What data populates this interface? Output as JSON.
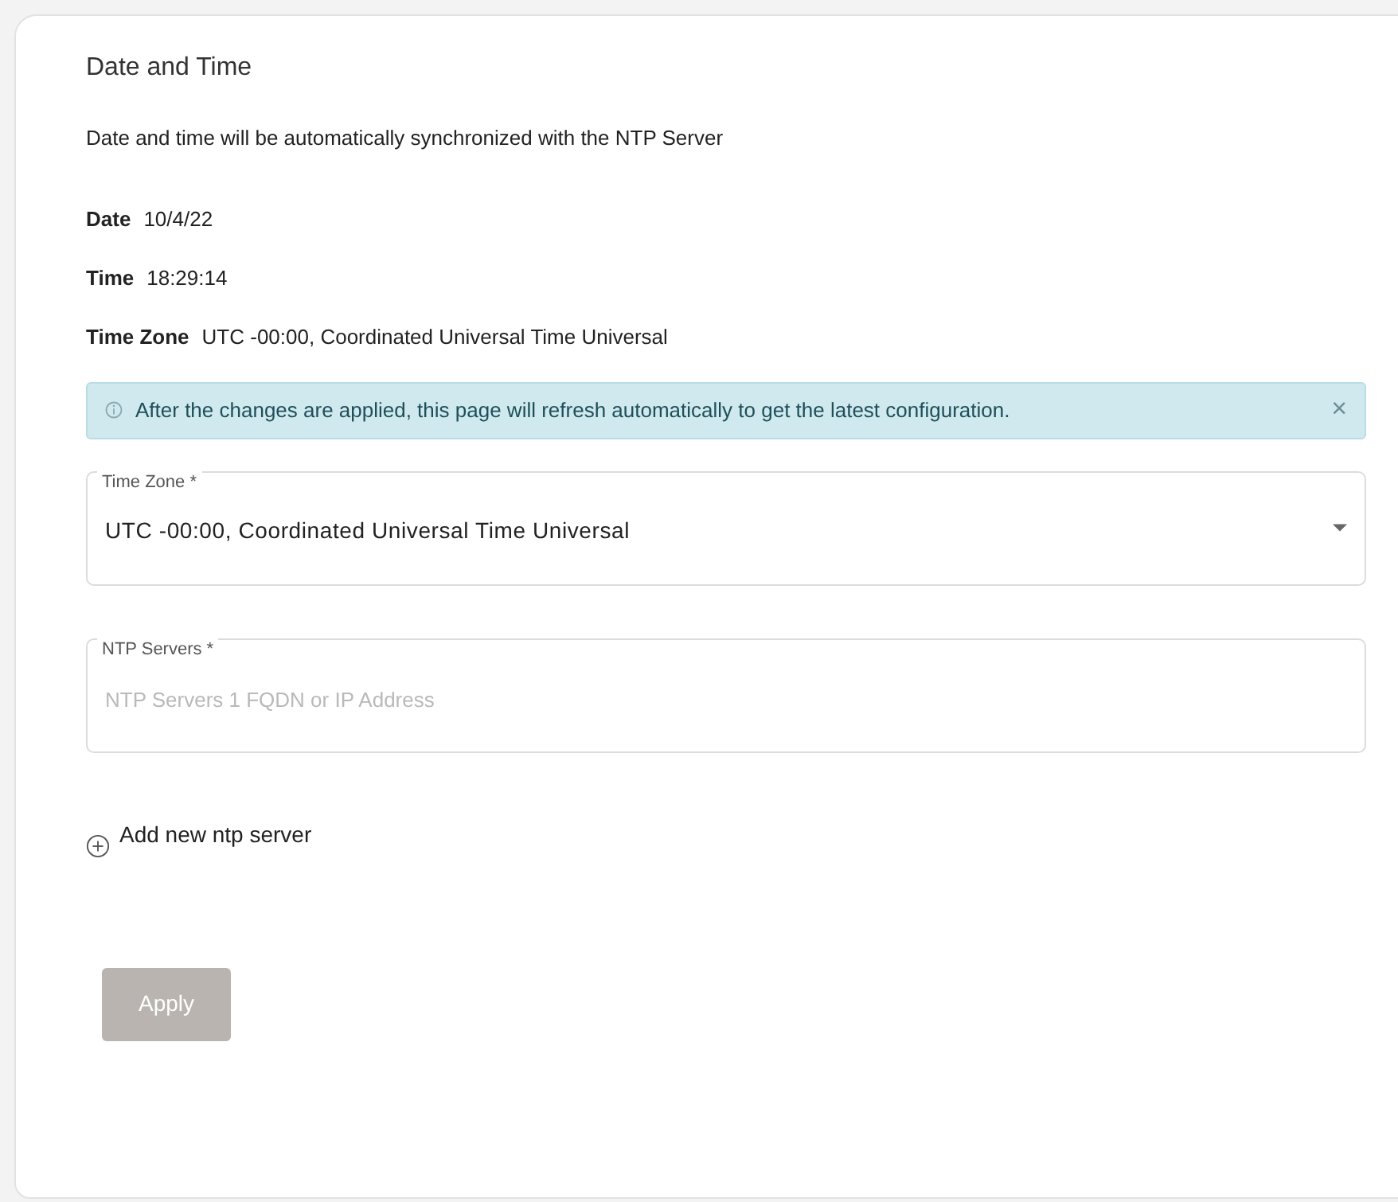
{
  "title": "Date and Time",
  "description": "Date and time will be automatically synchronized with the NTP Server",
  "info": [
    {
      "label": "Date",
      "value": "10/4/22"
    },
    {
      "label": "Time",
      "value": "18:29:14"
    },
    {
      "label": "Time Zone",
      "value": "UTC -00:00, Coordinated Universal Time Universal"
    }
  ],
  "alert": {
    "text": "After the changes are applied, this page will refresh automatically to get the latest configuration.",
    "close": "×"
  },
  "fields": [
    {
      "kind": "select",
      "label": "Time Zone *",
      "value": "UTC -00:00, Coordinated Universal Time Universal"
    },
    {
      "kind": "text",
      "label": "NTP Servers *",
      "placeholder": "NTP Servers 1 FQDN or IP Address"
    }
  ],
  "add_link": "Add new ntp server",
  "apply_button": {
    "label": "Apply",
    "disabled": true
  }
}
